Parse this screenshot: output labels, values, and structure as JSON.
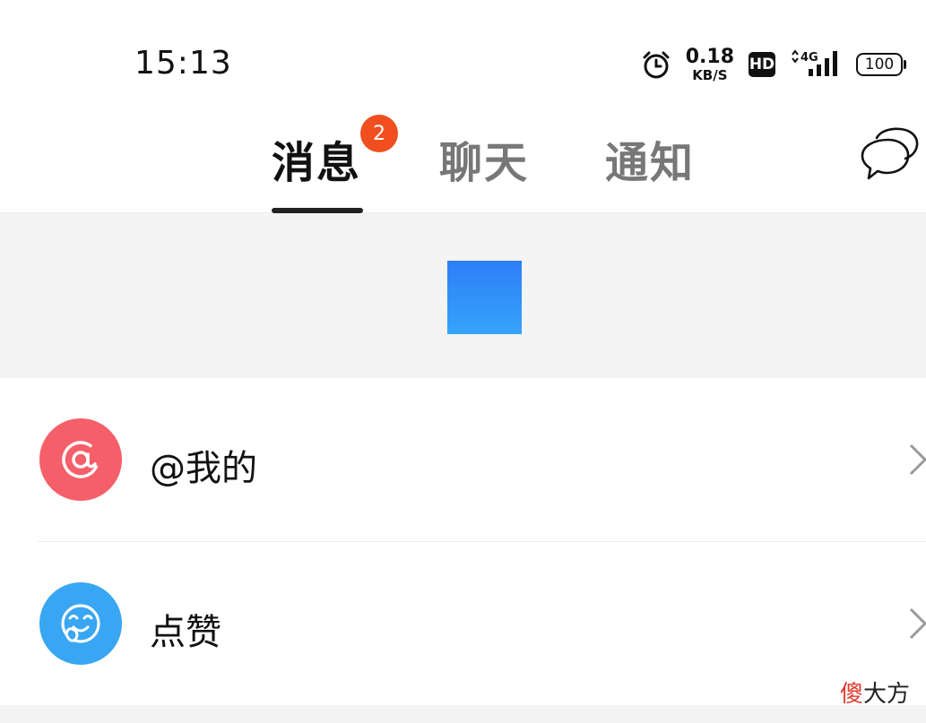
{
  "status_bar": {
    "time": "15:13",
    "net_speed_value": "0.18",
    "net_speed_unit": "KB/S",
    "hd_label": "HD",
    "network_label": "4G",
    "battery_level": "100",
    "icons": [
      "alarm-icon",
      "hd-icon",
      "signal-icon",
      "battery-icon"
    ]
  },
  "tabs": [
    {
      "label": "消息",
      "active": true,
      "badge": "2"
    },
    {
      "label": "聊天",
      "active": false
    },
    {
      "label": "通知",
      "active": false
    }
  ],
  "header_icons": [
    "chat-bubbles-icon"
  ],
  "banner": {
    "image_color": "#2f86f7"
  },
  "list": [
    {
      "label": "@我的",
      "icon": "at-icon",
      "icon_bg": "#f45f69"
    },
    {
      "label": "点赞",
      "icon": "like-face-icon",
      "icon_bg": "#38a6f2"
    }
  ],
  "watermark": {
    "accent": "傻",
    "rest": "大方"
  },
  "colors": {
    "badge": "#f04e1e",
    "active_tab": "#111111",
    "inactive_tab": "#777777"
  }
}
